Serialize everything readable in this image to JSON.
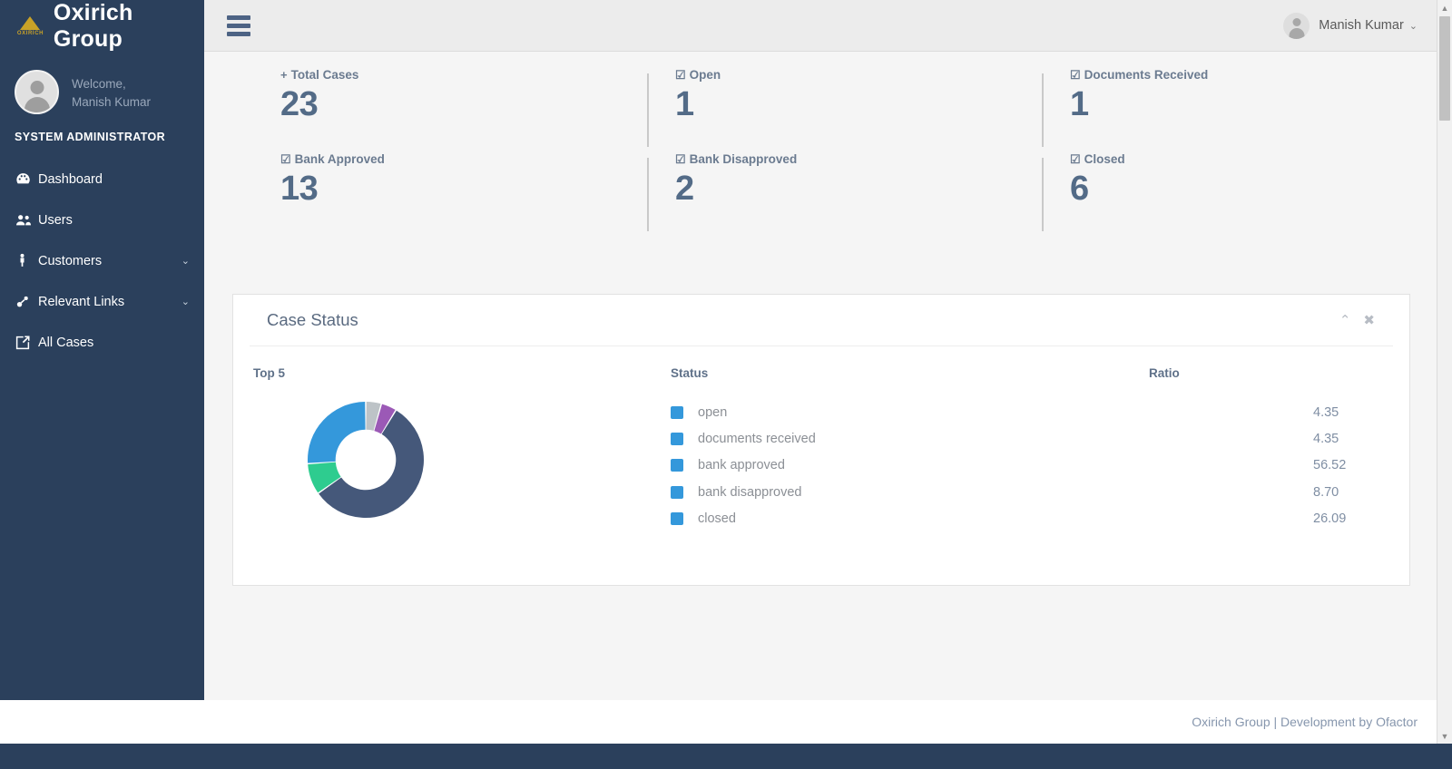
{
  "brand": {
    "logo_word": "OXIRICH",
    "title": "Oxirich Group",
    "logo_color": "#c9a227"
  },
  "sidebar": {
    "welcome_line1": "Welcome,",
    "welcome_line2": "Manish Kumar",
    "role": "SYSTEM ADMINISTRATOR",
    "bg_color": "#2b405c",
    "items": [
      {
        "label": "Dashboard",
        "icon": "dashboard-icon",
        "has_caret": false,
        "caret": ""
      },
      {
        "label": "Users",
        "icon": "users-icon",
        "has_caret": false,
        "caret": ""
      },
      {
        "label": "Customers",
        "icon": "person-icon",
        "has_caret": true,
        "caret": "⌄"
      },
      {
        "label": "Relevant Links",
        "icon": "link-icon",
        "has_caret": true,
        "caret": "⌄"
      },
      {
        "label": "All Cases",
        "icon": "external-link-icon",
        "has_caret": false,
        "caret": ""
      }
    ]
  },
  "topbar": {
    "menu_icon": "hamburger-icon",
    "user_name": "Manish Kumar",
    "user_caret": "⌄"
  },
  "stats": [
    {
      "label": "Total Cases",
      "icon": "plus-icon",
      "glyph": "+",
      "value": "23"
    },
    {
      "label": "Open",
      "icon": "check-box-icon",
      "glyph": "☑",
      "value": "1"
    },
    {
      "label": "Documents Received",
      "icon": "check-box-icon",
      "glyph": "☑",
      "value": "1"
    },
    {
      "label": "Bank Approved",
      "icon": "check-box-icon",
      "glyph": "☑",
      "value": "13"
    },
    {
      "label": "Bank Disapproved",
      "icon": "check-box-icon",
      "glyph": "☑",
      "value": "2"
    },
    {
      "label": "Closed",
      "icon": "check-box-icon",
      "glyph": "☑",
      "value": "6"
    }
  ],
  "panel": {
    "title": "Case Status",
    "collapse_icon": "chevron-up-icon",
    "collapse_glyph": "⌃",
    "close_icon": "close-icon",
    "close_glyph": "✖",
    "col_chart": "Top 5",
    "col_status": "Status",
    "col_ratio": "Ratio",
    "swatch_color": "#3498db"
  },
  "chart_data": {
    "type": "pie",
    "title": "Case Status",
    "subtitle": "Top 5",
    "donut": true,
    "inner_radius_ratio": 0.52,
    "start_angle": -90,
    "labels": [
      "open",
      "documents received",
      "bank approved",
      "bank disapproved",
      "closed"
    ],
    "values": [
      4.35,
      4.35,
      56.52,
      8.7,
      26.09
    ],
    "value_suffix": "",
    "display_values": [
      "4.35",
      "4.35",
      "56.52",
      "8.70",
      "26.09"
    ],
    "slice_colors": [
      "#bdc3c7",
      "#9b59b6",
      "#45587a",
      "#2ecc8f",
      "#3498db"
    ],
    "legend_swatch_colors": [
      "#3498db",
      "#3498db",
      "#3498db",
      "#3498db",
      "#3498db"
    ],
    "legend_position": "right",
    "grid": false,
    "xlabel": "",
    "ylabel": ""
  },
  "footer": {
    "text": "Oxirich Group | Development by Ofactor"
  },
  "scrollbar": {
    "up_glyph": "▲",
    "down_glyph": "▼"
  }
}
